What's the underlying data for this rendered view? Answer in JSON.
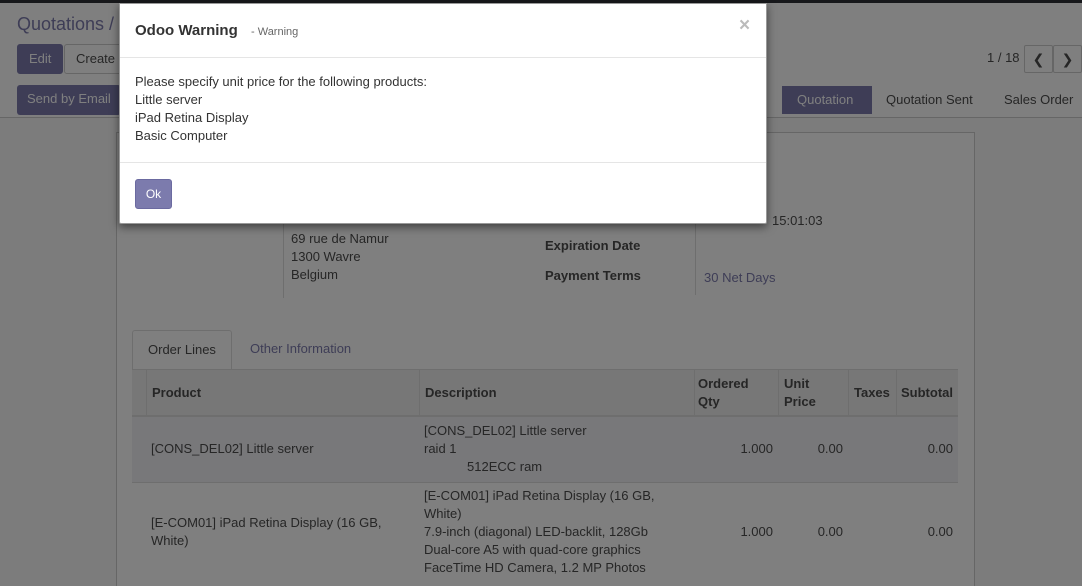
{
  "control_panel": {
    "breadcrumb": "Quotations /",
    "edit_label": "Edit",
    "create_label": "Create",
    "pager_value": "1 / 18",
    "prev_icon": "chevron-left",
    "next_icon": "chevron-right"
  },
  "statusbar": {
    "send_email_label": "Send by Email",
    "stages": [
      "Quotation",
      "Quotation Sent",
      "Sales Order"
    ],
    "active_stage": "Quotation"
  },
  "sheet": {
    "address": [
      "69 rue de Namur",
      "1300 Wavre",
      "Belgium"
    ],
    "quotation_datetime": "15:01:03",
    "expiration_label": "Expiration Date",
    "payment_terms_label": "Payment Terms",
    "payment_terms_value": "30 Net Days"
  },
  "tabs": [
    "Order Lines",
    "Other Information"
  ],
  "table": {
    "headers": {
      "product": "Product",
      "description": "Description",
      "ordered_qty_1": "Ordered",
      "ordered_qty_2": "Qty",
      "unit_price_1": "Unit",
      "unit_price_2": "Price",
      "taxes": "Taxes",
      "subtotal": "Subtotal"
    },
    "rows": [
      {
        "product": "[CONS_DEL02] Little server",
        "description": [
          "[CONS_DEL02] Little server",
          "raid 1",
          "512ECC ram"
        ],
        "qty": "1.000",
        "price": "0.00",
        "subtotal": "0.00"
      },
      {
        "product_1": "[E-COM01] iPad Retina Display (16 GB,",
        "product_2": "White)",
        "description": [
          "[E-COM01] iPad Retina Display (16 GB,",
          "White)",
          "7.9-inch (diagonal) LED-backlit, 128Gb",
          "Dual-core A5 with quad-core graphics",
          "FaceTime HD Camera, 1.2 MP Photos"
        ],
        "qty": "1.000",
        "price": "0.00",
        "subtotal": "0.00"
      }
    ]
  },
  "modal": {
    "title": "Odoo Warning",
    "subtitle": "- Warning",
    "close_glyph": "×",
    "message": "Please specify unit price for the following products:",
    "products": [
      "Little server",
      "iPad Retina Display",
      "Basic Computer"
    ],
    "ok_label": "Ok"
  },
  "colors": {
    "brand": "#7c7bad",
    "overlay": "rgba(0,0,0,0.5)"
  }
}
